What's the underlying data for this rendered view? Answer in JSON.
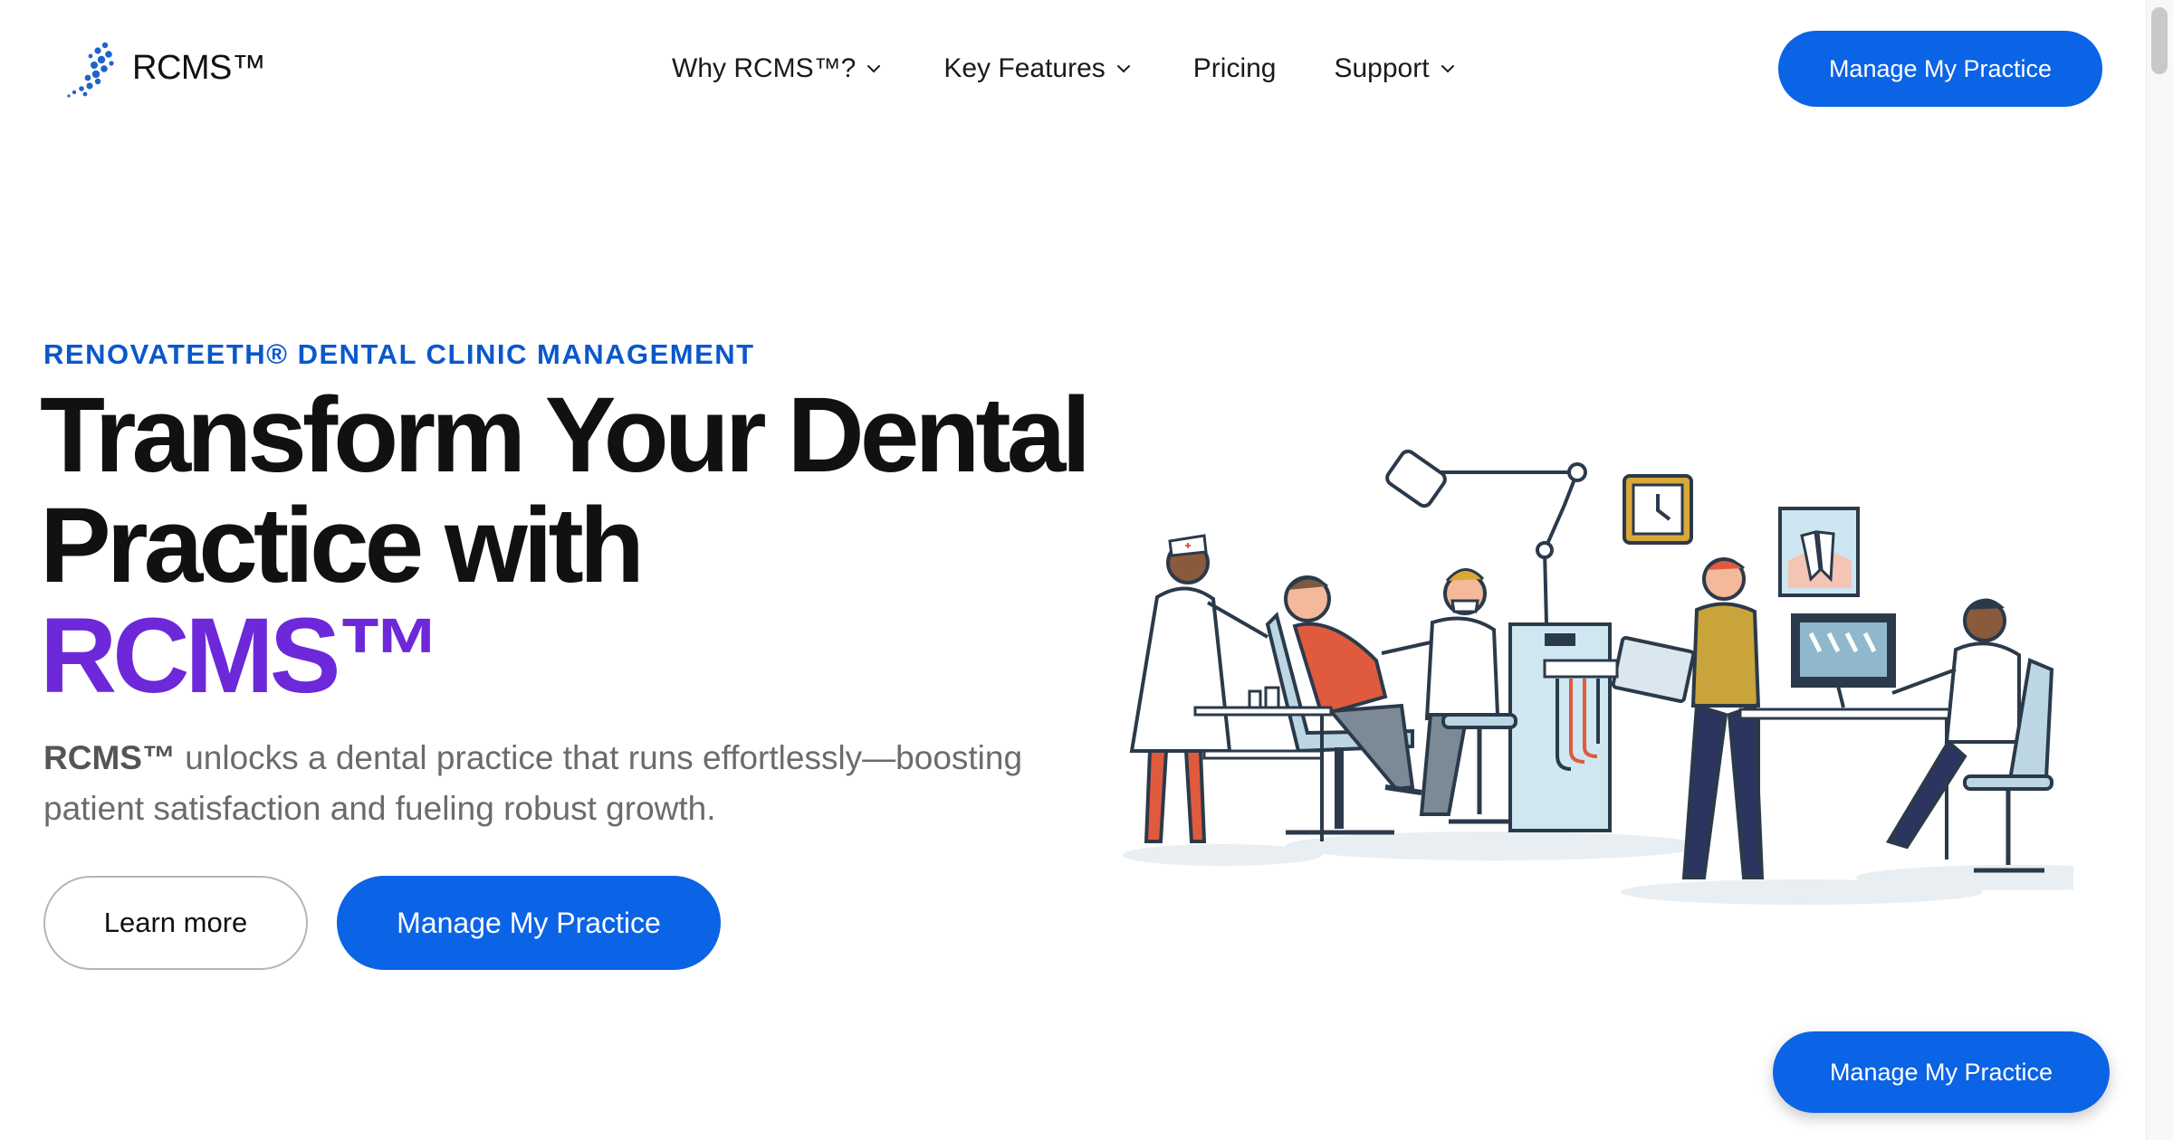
{
  "brand": {
    "name": "RCMS™",
    "accent_color": "#0b63e5",
    "highlight_color": "#6d28d9",
    "logo_icon": "dotted-swirl-logo"
  },
  "nav": {
    "items": [
      {
        "label": "Why RCMS™?",
        "has_dropdown": true
      },
      {
        "label": "Key Features",
        "has_dropdown": true
      },
      {
        "label": "Pricing",
        "has_dropdown": false
      },
      {
        "label": "Support",
        "has_dropdown": true
      }
    ],
    "cta_label": "Manage My Practice"
  },
  "hero": {
    "eyebrow": "RENOVATEETH® DENTAL CLINIC MANAGEMENT",
    "headline_line1": "Transform Your Dental",
    "headline_line2": "Practice with",
    "headline_accent": "RCMS™",
    "sub_brand": "RCMS™",
    "sub_text": " unlocks a dental practice that runs effortlessly—boosting patient satisfaction and fueling robust growth.",
    "secondary_button": "Learn more",
    "primary_button": "Manage My Practice",
    "illustration_icon": "dental-clinic-illustration"
  },
  "floating_cta": {
    "label": "Manage My Practice"
  }
}
